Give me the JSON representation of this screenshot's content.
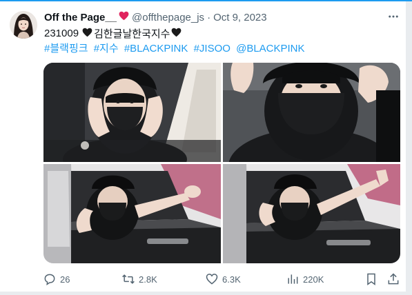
{
  "tweet": {
    "display_name": "Off the Page__",
    "name_emoji": "red-heart",
    "handle": "@offthepage_js",
    "separator": "·",
    "date": "Oct 9, 2023",
    "text_prefix": "231009",
    "text_middle": "김한글날한국지수",
    "text_emoji": "black-heart",
    "hashtags": [
      "#블랙핑크",
      "#지수",
      "#BLACKPINK",
      "#JISOO",
      "@BLACKPINK"
    ]
  },
  "media": {
    "photos": [
      "photo-1",
      "photo-2",
      "photo-3",
      "photo-4"
    ]
  },
  "actions": {
    "replies": "26",
    "retweets": "2.8K",
    "likes": "6.3K",
    "views": "220K"
  },
  "icons": [
    "more-icon",
    "reply-icon",
    "retweet-icon",
    "like-icon",
    "views-icon",
    "bookmark-icon",
    "share-icon"
  ],
  "colors": {
    "accent": "#1d9bf0",
    "text": "#0f1419",
    "secondary": "#536471",
    "heart": "#e0245e"
  }
}
